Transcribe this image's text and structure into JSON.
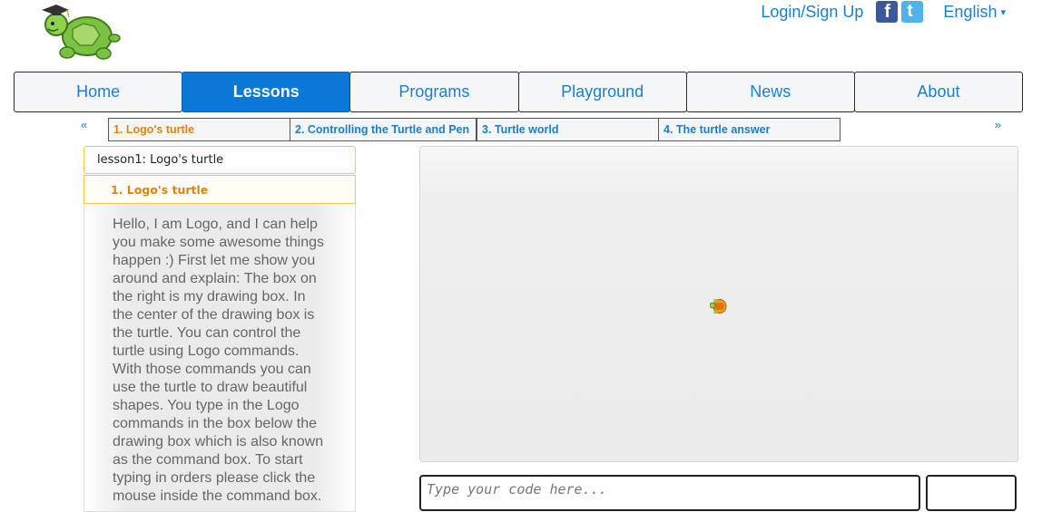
{
  "topbar": {
    "login_label": "Login/Sign Up",
    "language": "English",
    "facebook_glyph": "f",
    "twitter_glyph": "t"
  },
  "icons": {
    "logo": "turtle-graduate-logo",
    "facebook": "facebook-icon",
    "twitter": "twitter-icon",
    "turtle": "turtle-icon"
  },
  "colors": {
    "link": "#1a7fd0",
    "active_nav": "#0a78d6",
    "active_lesson": "#e0830d"
  },
  "nav": {
    "items": [
      {
        "label": "Home"
      },
      {
        "label": "Lessons"
      },
      {
        "label": "Programs"
      },
      {
        "label": "Playground"
      },
      {
        "label": "News"
      },
      {
        "label": "About"
      }
    ],
    "active": "Lessons"
  },
  "lesson_nav": {
    "prev": "«",
    "next": "»",
    "tabs": [
      {
        "label": "1. Logo's turtle"
      },
      {
        "label": "2. Controlling the Turtle and Pen"
      },
      {
        "label": "3. Turtle world"
      },
      {
        "label": "4. The turtle answer"
      }
    ]
  },
  "lesson": {
    "header": "lesson1: Logo's turtle",
    "sub": "1. Logo's turtle",
    "body": "Hello, I am Logo, and I can help you make some awesome things happen :) First let me show you around and explain: The box on the right is my drawing box. In the center of the drawing box is the turtle. You can control the turtle using Logo commands. With those commands you can use the turtle to draw beautiful shapes. You type in the Logo commands in the box below the drawing box which is also known as the command box. To start typing in orders please click the mouse inside the command box."
  },
  "command": {
    "placeholder": "Type your code here..."
  }
}
